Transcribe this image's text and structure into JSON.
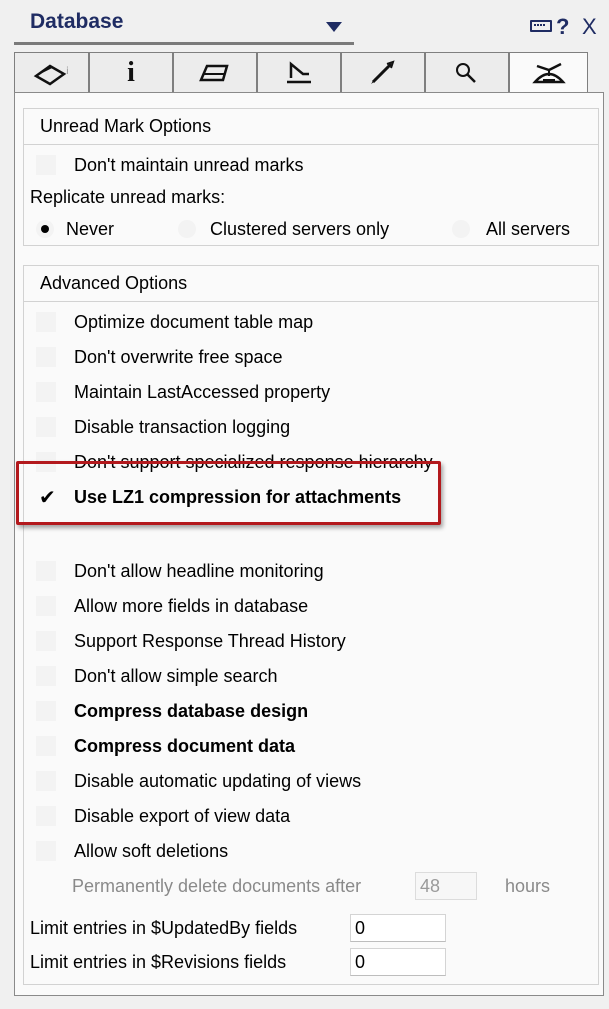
{
  "titlebar": {
    "title": "Database",
    "help": "?",
    "close": "X"
  },
  "tabs": [
    {
      "name": "basics",
      "icon": "database-tab-icon"
    },
    {
      "name": "info",
      "icon": "info-icon",
      "glyph": "i"
    },
    {
      "name": "printing",
      "icon": "printer-icon"
    },
    {
      "name": "design",
      "icon": "design-icon"
    },
    {
      "name": "launch",
      "icon": "rocket-icon"
    },
    {
      "name": "fulltext",
      "icon": "magnifier-icon"
    },
    {
      "name": "advanced",
      "icon": "propeller-hat-icon",
      "active": true
    }
  ],
  "unread": {
    "title": "Unread Mark Options",
    "dont_maintain": "Don't maintain unread marks",
    "replicate_label": "Replicate unread marks:",
    "radio_never": "Never",
    "radio_clustered": "Clustered servers only",
    "radio_all": "All servers",
    "selected": "Never"
  },
  "advanced": {
    "title": "Advanced Options",
    "items": [
      {
        "label": "Optimize document table map",
        "checked": false,
        "bold": false
      },
      {
        "label": "Don't overwrite free space",
        "checked": false,
        "bold": false
      },
      {
        "label": "Maintain LastAccessed property",
        "checked": false,
        "bold": false
      },
      {
        "label": "Disable transaction logging",
        "checked": false,
        "bold": false
      },
      {
        "label": "Don't support specialized response hierarchy",
        "checked": false,
        "bold": false
      },
      {
        "label": "Use LZ1 compression for attachments",
        "checked": true,
        "bold": true
      },
      {
        "label": "Don't allow headline monitoring",
        "checked": false,
        "bold": false
      },
      {
        "label": "Allow more fields in database",
        "checked": false,
        "bold": false
      },
      {
        "label": "Support Response Thread History",
        "checked": false,
        "bold": false
      },
      {
        "label": "Don't allow simple search",
        "checked": false,
        "bold": false
      },
      {
        "label": "Compress database design",
        "checked": false,
        "bold": true
      },
      {
        "label": "Compress document data",
        "checked": false,
        "bold": true
      },
      {
        "label": "Disable automatic updating of views",
        "checked": false,
        "bold": false
      },
      {
        "label": "Disable export of view data",
        "checked": false,
        "bold": false
      },
      {
        "label": "Allow soft deletions",
        "checked": false,
        "bold": false
      }
    ],
    "soft_delete_prefix": "Permanently delete documents after",
    "soft_delete_value": "48",
    "soft_delete_unit": "hours",
    "updatedby_label": "Limit entries in $UpdatedBy fields",
    "updatedby_value": "0",
    "revisions_label": "Limit entries in $Revisions fields",
    "revisions_value": "0"
  },
  "colors": {
    "title": "#1f2c63",
    "highlight": "#b3191d"
  }
}
